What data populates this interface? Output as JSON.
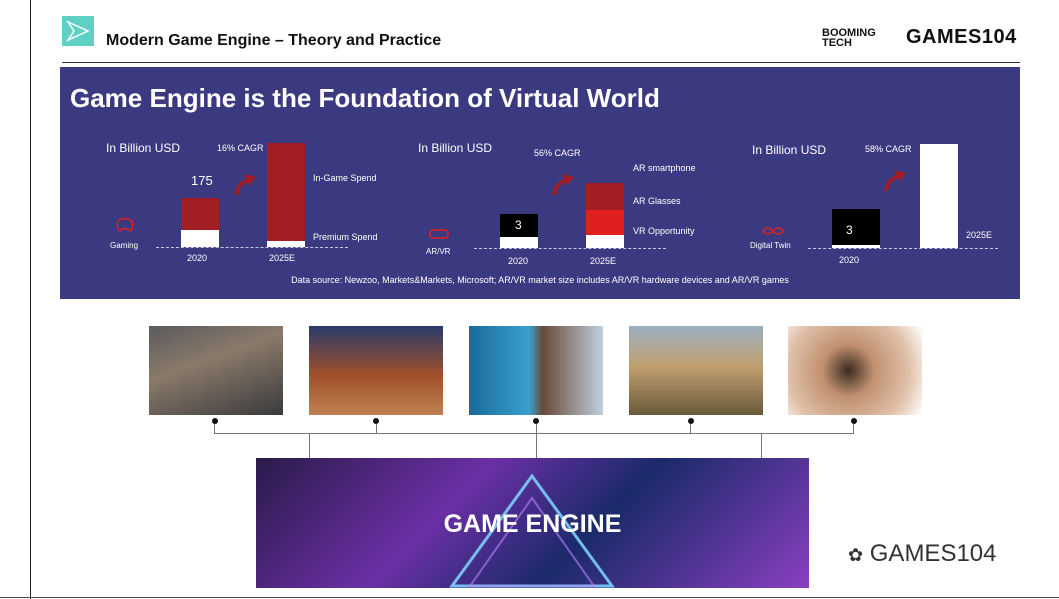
{
  "header": {
    "title": "Modern Game Engine – Theory and Practice",
    "brand_booming": "BOOMING",
    "brand_tech": "TECH",
    "brand_games": "GAMES104"
  },
  "slogan": "Game Engine is the Foundation of Virtual World",
  "markets": [
    {
      "unit": "In Billion USD",
      "cagr": "16% CAGR",
      "icon_label": "Gaming",
      "value_2020": "175",
      "year_2020": "2020",
      "year_2025": "2025E",
      "segments_2025": [
        "In-Game Spend",
        "Premium Spend"
      ]
    },
    {
      "unit": "In Billion USD",
      "cagr": "56% CAGR",
      "icon_label": "AR/VR",
      "value_2020": "3",
      "year_2020": "2020",
      "year_2025": "2025E",
      "segments_2025": [
        "AR smartphone",
        "AR Glasses",
        "VR Opportunity"
      ]
    },
    {
      "unit": "In Billion USD",
      "cagr": "58% CAGR",
      "icon_label": "Digital Twin",
      "value_2020": "3",
      "year_2020": "2020",
      "year_2025": "2025E"
    }
  ],
  "source_note": "Data source: Newzoo, Markets&Markets, Microsoft; AR/VR market size includes AR/VR hardware devices and AR/VR games",
  "engine_label": "GAME ENGINE",
  "watermark": "GAMES104",
  "colors": {
    "panel": "#3b3a80",
    "bar_red": "#a11f24",
    "bar_bright_red": "#e02020",
    "accent": "#5fd0c4"
  }
}
